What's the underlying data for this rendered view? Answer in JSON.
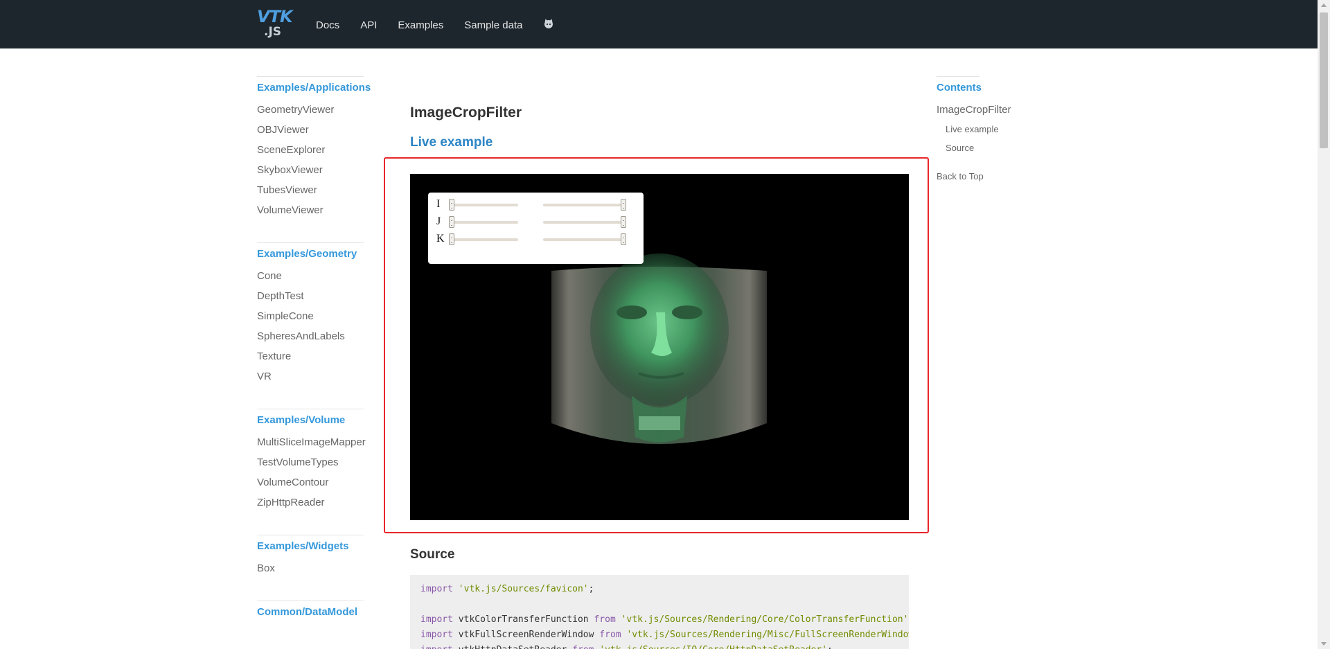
{
  "header": {
    "logo_top": "VTK",
    "logo_bottom": ".JS",
    "nav": [
      {
        "label": "Docs"
      },
      {
        "label": "API"
      },
      {
        "label": "Examples"
      },
      {
        "label": "Sample data"
      }
    ],
    "github_icon": "github-icon"
  },
  "sidebar": {
    "groups": [
      {
        "title": "Examples/Applications",
        "items": [
          "GeometryViewer",
          "OBJViewer",
          "SceneExplorer",
          "SkyboxViewer",
          "TubesViewer",
          "VolumeViewer"
        ]
      },
      {
        "title": "Examples/Geometry",
        "items": [
          "Cone",
          "DepthTest",
          "SimpleCone",
          "SpheresAndLabels",
          "Texture",
          "VR"
        ]
      },
      {
        "title": "Examples/Volume",
        "items": [
          "MultiSliceImageMapper",
          "TestVolumeTypes",
          "VolumeContour",
          "ZipHttpReader"
        ]
      },
      {
        "title": "Examples/Widgets",
        "items": [
          "Box"
        ]
      },
      {
        "title": "Common/DataModel",
        "items": []
      }
    ]
  },
  "toc": {
    "title": "Contents",
    "items": [
      {
        "label": "ImageCropFilter",
        "level": 1
      },
      {
        "label": "Live example",
        "level": 2
      },
      {
        "label": "Source",
        "level": 2
      }
    ],
    "back": "Back to Top"
  },
  "main": {
    "title": "ImageCropFilter",
    "live_heading": "Live example",
    "source_heading": "Source",
    "highlight_color": "#e8262a",
    "controls": [
      {
        "label": "I",
        "min": 0,
        "max": 1
      },
      {
        "label": "J",
        "min": 0,
        "max": 1
      },
      {
        "label": "K",
        "min": 0,
        "max": 1
      }
    ],
    "code_lines": [
      [
        {
          "t": "kw",
          "v": "import "
        },
        {
          "t": "str",
          "v": "'vtk.js/Sources/favicon'"
        },
        {
          "t": "p",
          "v": ";"
        }
      ],
      [],
      [
        {
          "t": "kw",
          "v": "import "
        },
        {
          "t": "p",
          "v": "vtkColorTransferFunction "
        },
        {
          "t": "kw",
          "v": "from "
        },
        {
          "t": "str",
          "v": "'vtk.js/Sources/Rendering/Core/ColorTransferFunction'"
        },
        {
          "t": "p",
          "v": ";"
        }
      ],
      [
        {
          "t": "kw",
          "v": "import "
        },
        {
          "t": "p",
          "v": "vtkFullScreenRenderWindow "
        },
        {
          "t": "kw",
          "v": "from "
        },
        {
          "t": "str",
          "v": "'vtk.js/Sources/Rendering/Misc/FullScreenRenderWindow'"
        },
        {
          "t": "p",
          "v": ";"
        }
      ],
      [
        {
          "t": "kw",
          "v": "import "
        },
        {
          "t": "p",
          "v": "vtkHttpDataSetReader "
        },
        {
          "t": "kw",
          "v": "from "
        },
        {
          "t": "str",
          "v": "'vtk.js/Sources/IO/Core/HttpDataSetReader'"
        },
        {
          "t": "p",
          "v": ";"
        }
      ]
    ]
  }
}
